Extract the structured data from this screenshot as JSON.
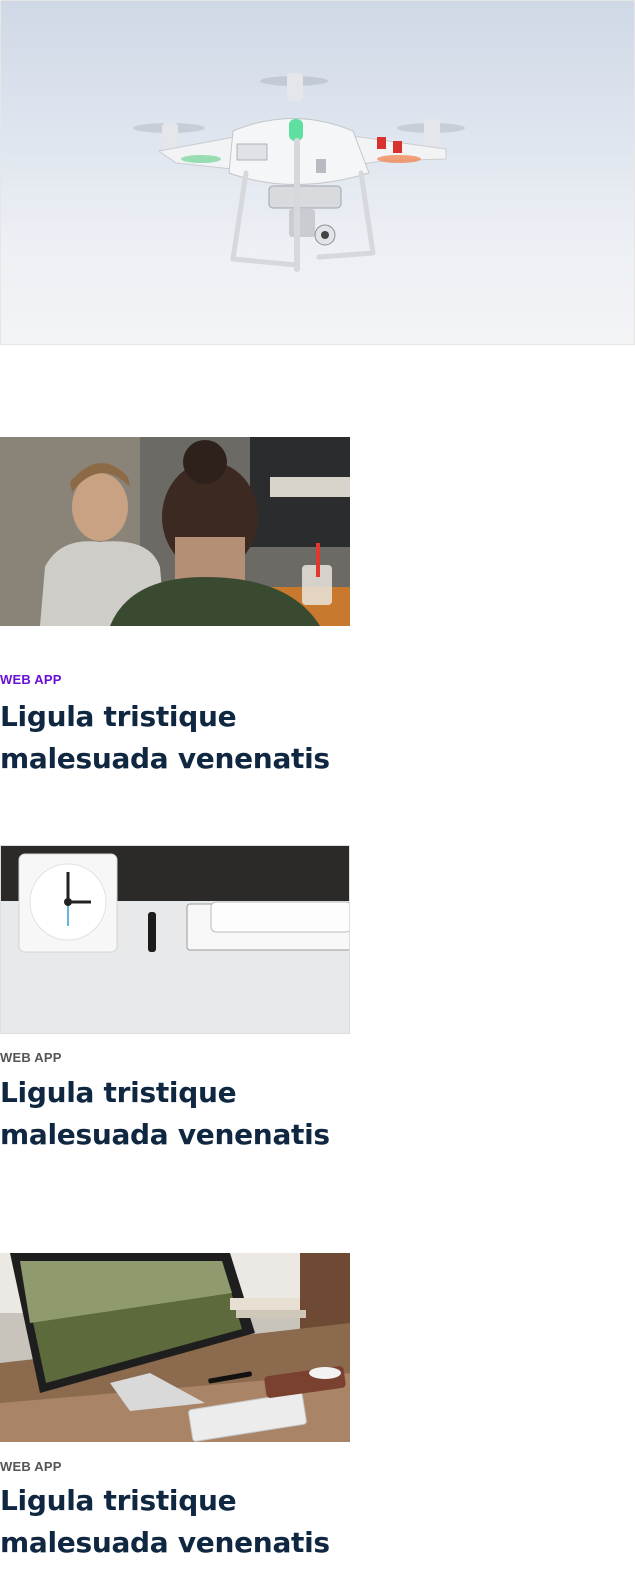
{
  "hero": {
    "image": "drone-photo"
  },
  "cards": [
    {
      "category": "WEB APP",
      "title": "Ligula tristique malesuada venenatis",
      "category_color": "#6a0fd6",
      "image": "meeting-photo"
    },
    {
      "category": "WEB APP",
      "title": "Ligula tristique malesuada venenatis",
      "category_color": "#555555",
      "image": "clock-desk-photo"
    },
    {
      "category": "WEB APP",
      "title": "Ligula tristique malesuada venenatis",
      "category_color": "#555555",
      "image": "monitor-desk-photo"
    }
  ]
}
